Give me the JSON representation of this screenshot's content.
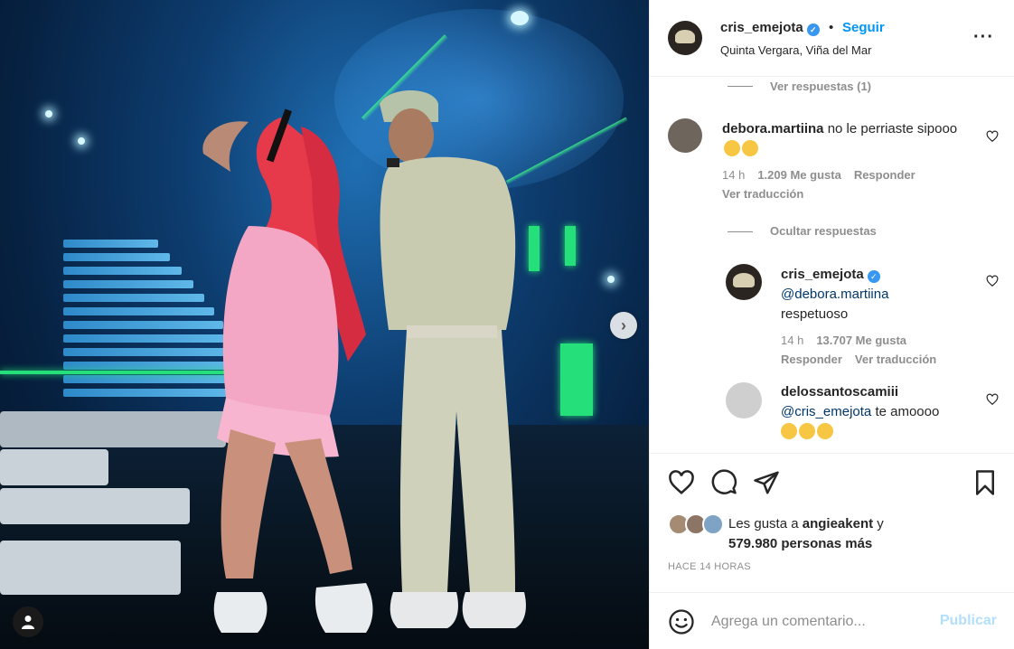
{
  "post": {
    "image_alt": "Two performers on a concert stage"
  },
  "header": {
    "username": "cris_emejota",
    "bullet": "•",
    "follow_label": "Seguir",
    "location": "Quinta Vergara, Viña del Mar",
    "more_label": "···"
  },
  "comments": {
    "view_replies_label": "Ver respuestas (1)",
    "items": [
      {
        "username": "debora.martiina",
        "text": "no le perriaste sipooo",
        "time": "14 h",
        "likes": "1.209 Me gusta",
        "reply_label": "Responder",
        "translate_label": "Ver traducción"
      }
    ],
    "hide_replies_label": "Ocultar respuestas",
    "replies": [
      {
        "username": "cris_emejota",
        "mention": "@debora.martiina",
        "text": "respetuoso",
        "time": "14 h",
        "likes": "13.707 Me gusta",
        "reply_label": "Responder",
        "translate_label": "Ver traducción"
      },
      {
        "username": "delossantoscamiii",
        "mention": "@cris_emejota",
        "text": "te amoooo"
      }
    ]
  },
  "likes": {
    "prefix": "Les gusta a",
    "first_user": "angieakent",
    "connector": "y",
    "others": "579.980 personas más"
  },
  "timestamp": "HACE 14 HORAS",
  "composer": {
    "placeholder": "Agrega un comentario...",
    "publish_label": "Publicar"
  },
  "colors": {
    "accent": "#0095f6",
    "publish_disabled": "#b2dffc",
    "muted": "#8e8e8e"
  },
  "icons": [
    "more-icon",
    "heart-icon",
    "comment-icon",
    "share-icon",
    "bookmark-icon",
    "smile-icon",
    "next-arrow-icon",
    "user-tag-icon",
    "verified-badge-icon"
  ]
}
